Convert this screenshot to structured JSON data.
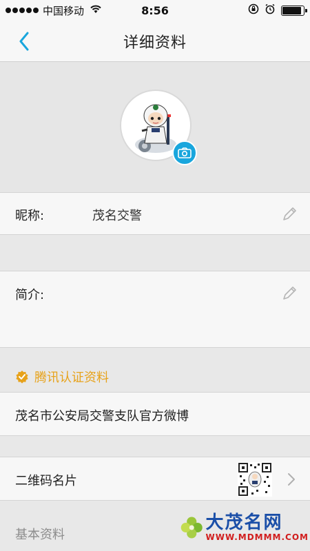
{
  "status_bar": {
    "carrier": "中国移动",
    "time": "8:56",
    "battery_level": 0.9
  },
  "nav": {
    "title": "详细资料",
    "back_icon": "chevron-left-icon"
  },
  "profile": {
    "avatar_desc": "traffic police cartoon",
    "camera_icon": "camera-icon"
  },
  "nickname": {
    "label": "昵称:",
    "value": "茂名交警"
  },
  "intro": {
    "label": "简介:",
    "value": ""
  },
  "verification": {
    "header": "腾讯认证资料",
    "text": "茂名市公安局交警支队官方微博"
  },
  "qr_card": {
    "label": "二维码名片"
  },
  "basic_info": {
    "label": "基本资料"
  },
  "watermark": {
    "title": "大茂名网",
    "url": "WWW.MDMMM.COM"
  },
  "colors": {
    "accent": "#19a6dd",
    "verify": "#e7a21a",
    "background": "#e8e8e8"
  }
}
